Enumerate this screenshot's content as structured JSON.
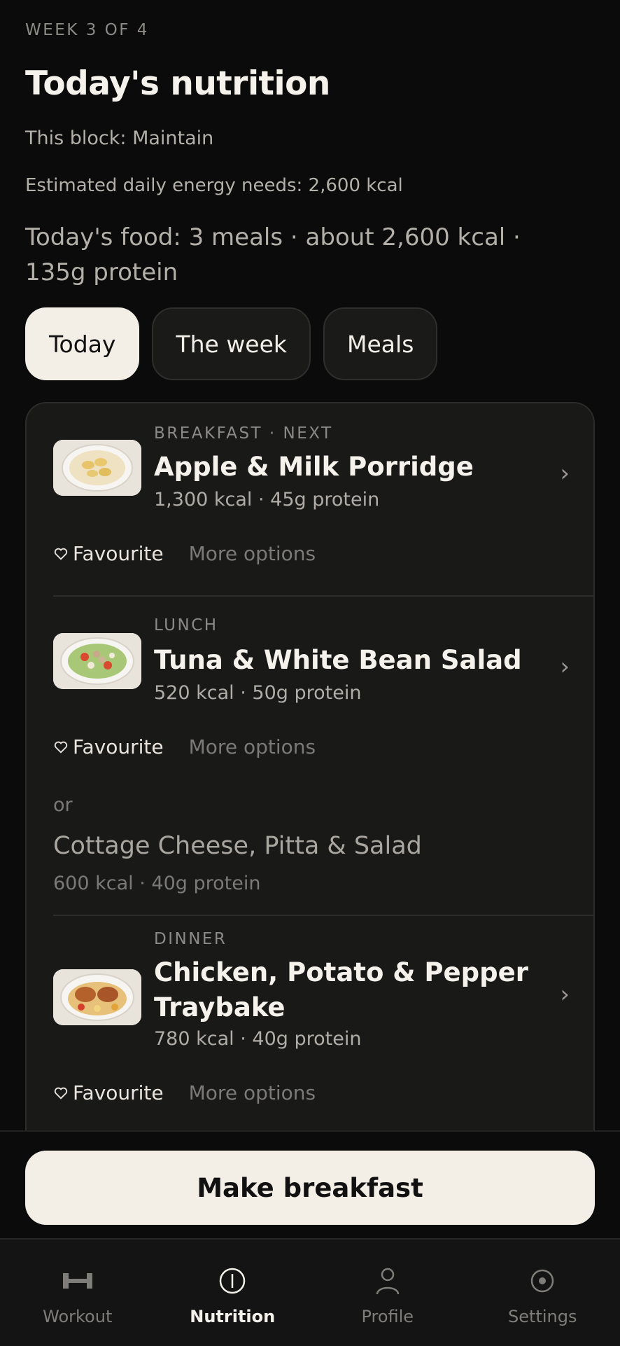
{
  "header": {
    "week_label": "WEEK 3 OF 4",
    "title": "Today's nutrition",
    "block": "This block: Maintain",
    "energy": "Estimated daily energy needs: 2,600 kcal",
    "food_summary": "Today's food: 3 meals · about 2,600 kcal · 135g protein"
  },
  "tabs": [
    {
      "label": "Today",
      "active": true
    },
    {
      "label": "The week",
      "active": false
    },
    {
      "label": "Meals",
      "active": false
    }
  ],
  "meals": [
    {
      "tag": "BREAKFAST · NEXT",
      "name": "Apple & Milk Porridge",
      "meta": "1,300 kcal · 45g protein",
      "image_icon": "porridge-bowl"
    },
    {
      "tag": "LUNCH",
      "name": "Tuna & White Bean Salad",
      "meta": "520 kcal · 50g protein",
      "image_icon": "salad-plate"
    },
    {
      "tag": "DINNER",
      "name": "Chicken, Potato & Pepper Traybake",
      "meta": "780 kcal · 40g protein",
      "image_icon": "traybake-plate"
    }
  ],
  "alternative": {
    "or_label": "or",
    "name": "Cottage Cheese, Pitta & Salad",
    "meta": "600 kcal · 40g protein"
  },
  "actions": {
    "favourite_label": "Favourite",
    "more_label": "More options"
  },
  "cta": {
    "label": "Make breakfast"
  },
  "nav": [
    {
      "label": "Workout",
      "icon": "dumbbell-icon",
      "active": false
    },
    {
      "label": "Nutrition",
      "icon": "nutrition-icon",
      "active": true
    },
    {
      "label": "Profile",
      "icon": "person-icon",
      "active": false
    },
    {
      "label": "Settings",
      "icon": "settings-icon",
      "active": false
    }
  ],
  "colors": {
    "background": "#0b0b0b",
    "card": "#191918",
    "accent_light": "#f3efe6",
    "muted_text": "#8c8a86"
  }
}
